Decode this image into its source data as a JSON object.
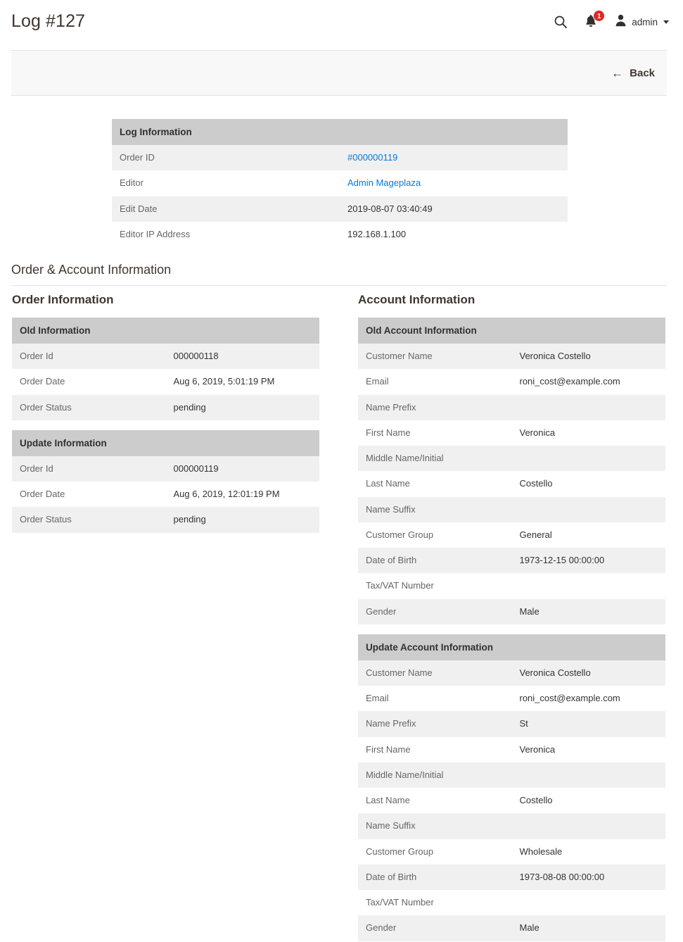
{
  "header": {
    "title": "Log #127",
    "search_icon": "search-icon",
    "notifications": {
      "icon": "bell-icon",
      "count": "1",
      "badge_color": "#e22626"
    },
    "user": {
      "icon": "user-avatar-icon",
      "name": "admin",
      "caret": "chevron-down-icon"
    }
  },
  "page_actions": {
    "back": {
      "arrow": "←",
      "label": "Back"
    }
  },
  "log_information": {
    "title": "Log Information",
    "rows": [
      {
        "label": "Order ID",
        "value": "#000000119",
        "link": true
      },
      {
        "label": "Editor",
        "value": "Admin Mageplaza",
        "link": true
      },
      {
        "label": "Edit Date",
        "value": "2019-08-07 03:40:49",
        "link": false
      },
      {
        "label": "Editor IP Address",
        "value": "192.168.1.100",
        "link": false
      }
    ]
  },
  "section": {
    "heading": "Order & Account Information"
  },
  "order_information": {
    "column_title": "Order Information",
    "old": {
      "title": "Old Information",
      "rows": [
        {
          "label": "Order Id",
          "value": "000000118"
        },
        {
          "label": "Order Date",
          "value": "Aug 6, 2019, 5:01:19 PM"
        },
        {
          "label": "Order Status",
          "value": "pending"
        }
      ]
    },
    "update": {
      "title": "Update Information",
      "rows": [
        {
          "label": "Order Id",
          "value": "000000119"
        },
        {
          "label": "Order Date",
          "value": "Aug 6, 2019, 12:01:19 PM"
        },
        {
          "label": "Order Status",
          "value": "pending"
        }
      ]
    }
  },
  "account_information": {
    "column_title": "Account Information",
    "old": {
      "title": "Old Account Information",
      "rows": [
        {
          "label": "Customer Name",
          "value": "Veronica Costello"
        },
        {
          "label": "Email",
          "value": "roni_cost@example.com"
        },
        {
          "label": "Name Prefix",
          "value": ""
        },
        {
          "label": "First Name",
          "value": "Veronica"
        },
        {
          "label": "Middle Name/Initial",
          "value": ""
        },
        {
          "label": "Last Name",
          "value": "Costello"
        },
        {
          "label": "Name Suffix",
          "value": ""
        },
        {
          "label": "Customer Group",
          "value": "General"
        },
        {
          "label": "Date of Birth",
          "value": "1973-12-15 00:00:00"
        },
        {
          "label": "Tax/VAT Number",
          "value": ""
        },
        {
          "label": "Gender",
          "value": "Male"
        }
      ]
    },
    "update": {
      "title": "Update Account Information",
      "rows": [
        {
          "label": "Customer Name",
          "value": "Veronica Costello"
        },
        {
          "label": "Email",
          "value": "roni_cost@example.com"
        },
        {
          "label": "Name Prefix",
          "value": "St"
        },
        {
          "label": "First Name",
          "value": "Veronica"
        },
        {
          "label": "Middle Name/Initial",
          "value": ""
        },
        {
          "label": "Last Name",
          "value": "Costello"
        },
        {
          "label": "Name Suffix",
          "value": ""
        },
        {
          "label": "Customer Group",
          "value": "Wholesale"
        },
        {
          "label": "Date of Birth",
          "value": "1973-08-08 00:00:00"
        },
        {
          "label": "Tax/VAT Number",
          "value": ""
        },
        {
          "label": "Gender",
          "value": "Male"
        }
      ]
    }
  },
  "colors": {
    "link": "#007bdb",
    "table_header_bg": "#cccccc",
    "row_alt_bg": "#f0f0f0",
    "badge": "#e22626",
    "heading_text": "#41362f"
  }
}
